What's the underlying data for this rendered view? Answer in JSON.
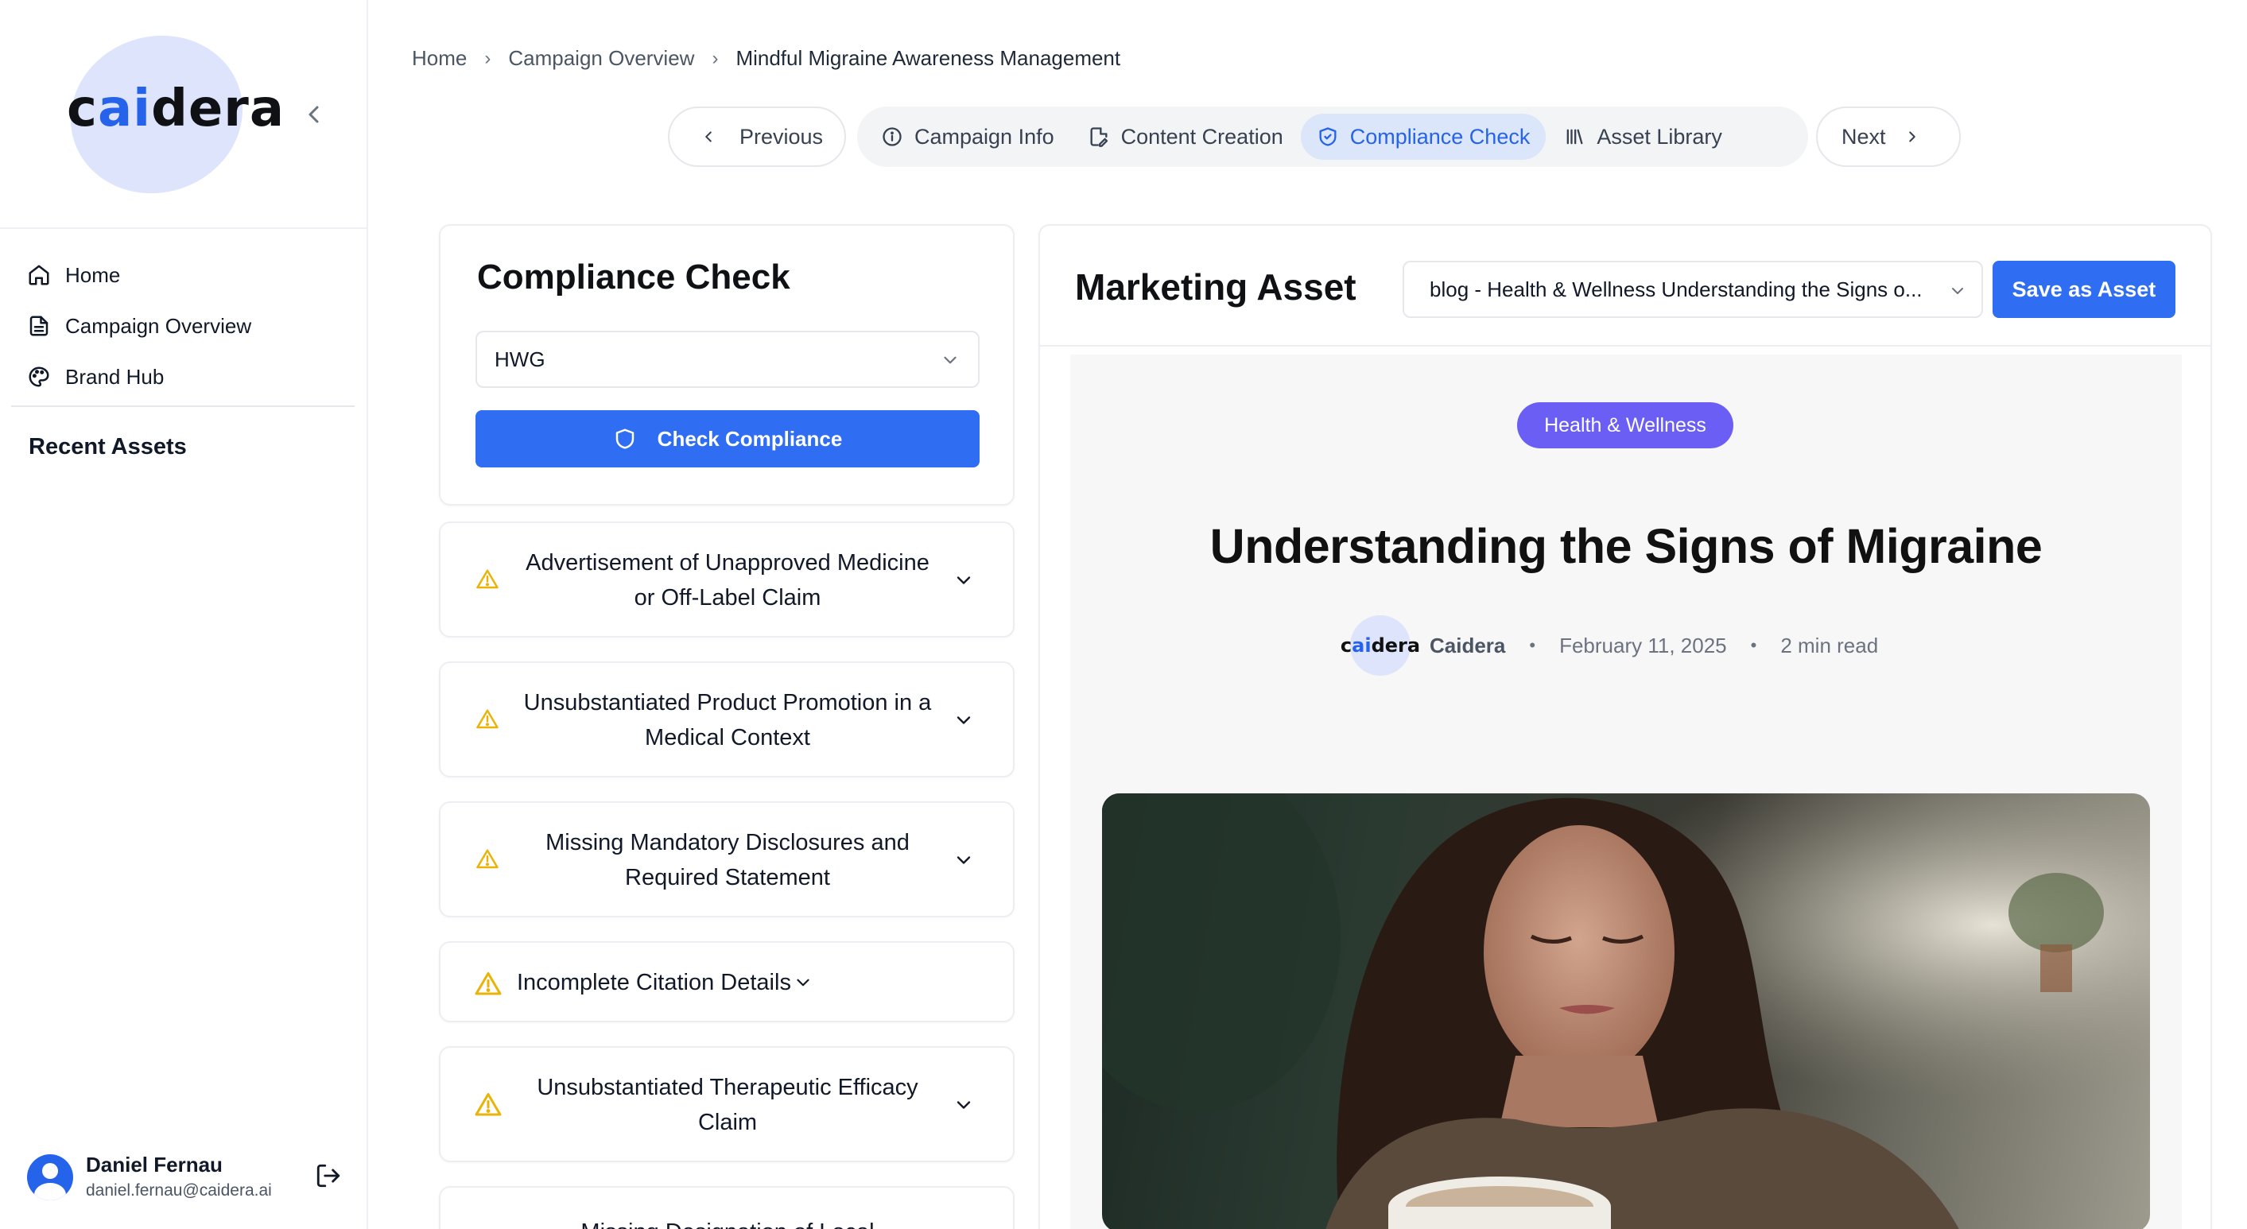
{
  "brand": {
    "logo_text_pre": "c",
    "logo_text_ai": "ai",
    "logo_text_post": "dera"
  },
  "sidebar": {
    "items": [
      {
        "label": "Home",
        "icon": "home-icon"
      },
      {
        "label": "Campaign Overview",
        "icon": "document-icon"
      },
      {
        "label": "Brand Hub",
        "icon": "palette-icon"
      }
    ],
    "recent_title": "Recent Assets",
    "user": {
      "name": "Daniel Fernau",
      "email": "daniel.fernau@caidera.ai"
    }
  },
  "breadcrumb": [
    "Home",
    "Campaign Overview",
    "Mindful Migraine Awareness Management"
  ],
  "stepnav": {
    "previous": "Previous",
    "next": "Next",
    "tabs": [
      {
        "label": "Campaign Info",
        "icon": "info-icon",
        "active": false
      },
      {
        "label": "Content Creation",
        "icon": "file-edit-icon",
        "active": false
      },
      {
        "label": "Compliance Check",
        "icon": "shield-check-icon",
        "active": true
      },
      {
        "label": "Asset Library",
        "icon": "library-icon",
        "active": false
      }
    ]
  },
  "compliance": {
    "title": "Compliance Check",
    "regulation": "HWG",
    "check_button": "Check Compliance",
    "issues": [
      "Advertisement of Unapproved Medicine or Off-Label Claim",
      "Unsubstantiated Product Promotion in a Medical Context",
      "Missing Mandatory Disclosures and Required Statement",
      "Incomplete Citation Details",
      "Unsubstantiated Therapeutic Efficacy Claim",
      "Missing Designation of Local"
    ]
  },
  "asset": {
    "title": "Marketing Asset",
    "selected": "blog - Health & Wellness Understanding the Signs o...",
    "save_button": "Save as Asset",
    "post": {
      "category": "Health & Wellness",
      "title": "Understanding the Signs of Migraine",
      "author_logo_pre": "c",
      "author_logo_ai": "ai",
      "author_logo_post": "dera",
      "author": "Caidera",
      "date": "February 11, 2025",
      "read_time": "2 min read"
    }
  },
  "colors": {
    "accent": "#2f6df2",
    "badge": "#6a5ef5",
    "warning": "#eab308"
  }
}
